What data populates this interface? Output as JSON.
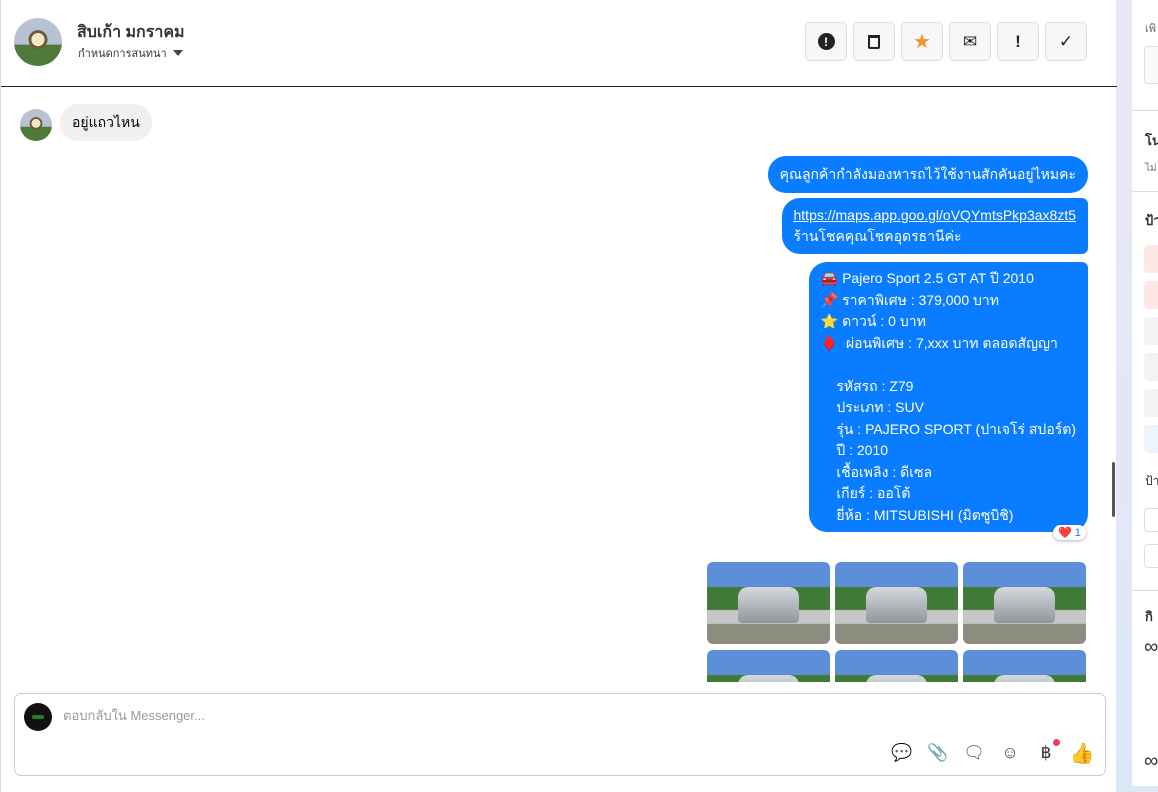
{
  "header": {
    "name": "สิบเก้า มกราคม",
    "subtitle": "กำหนดการสนทนา",
    "actions": [
      {
        "icon": "alert-circle-icon",
        "glyph": "❗"
      },
      {
        "icon": "trash-icon",
        "glyph": "🗑"
      },
      {
        "icon": "star-icon",
        "glyph": "★",
        "color": "#f0932b"
      },
      {
        "icon": "envelope-icon",
        "glyph": "✉"
      },
      {
        "icon": "exclamation-icon",
        "glyph": "!"
      },
      {
        "icon": "check-icon",
        "glyph": "✓"
      }
    ]
  },
  "messages": {
    "incoming": "อยู่แถวไหน",
    "out1": "คุณลูกค้ากำลังมองหารถไว้ใช้งานสักคันอยู่ไหมคะ",
    "out2_link": "https://maps.app.goo.gl/oVQYmtsPkp3ax8zt5",
    "out2_text": "ร้านโชคคุณโชคอุดรธานีค่ะ",
    "out3": [
      "🚘 Pajero Sport 2.5 GT AT ปี 2010",
      "📌 ราคาพิเศษ : 379,000 บาท",
      "⭐ ดาวน์ : 0 บาท",
      "♦️  ผ่อนพิเศษ : 7,xxx บาท ตลอดสัญญา",
      " ",
      "    รหัสรถ : Z79",
      "    ประเภท : SUV",
      "    รุ่น : PAJERO SPORT (ปาเจโร่ สปอร์ต)",
      "    ปี : 2010",
      "    เชื้อเพลิง : ดีเซล",
      "    เกียร์ : ออโต้",
      "    ยี่ห้อ : MITSUBISHI (มิตซูบิชิ)"
    ],
    "reaction": {
      "emoji": "❤️",
      "count": "1"
    }
  },
  "composer": {
    "placeholder": "ตอบกลับใน Messenger...",
    "tools": [
      "saved-reply-icon",
      "attachment-icon",
      "chat-bubble-icon",
      "emoji-icon",
      "baht-icon",
      "thumbs-up-icon"
    ]
  },
  "right_panel": {
    "labels": [
      "เพิ",
      "โน",
      "ไม่",
      "ป้า",
      "ป้า",
      "กิ"
    ]
  }
}
